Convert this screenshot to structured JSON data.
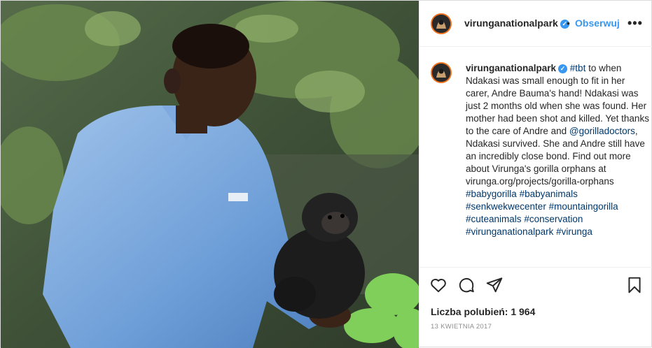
{
  "post": {
    "username": "virunganationalpark",
    "verified": "✓",
    "separator": "•",
    "follow_label": "Obserwuj",
    "more_label": "•••",
    "photo_alt": "Andre Bauma holding baby gorilla Ndakasi",
    "caption": {
      "username": "virunganationalpark",
      "hashtag_tbt": "#tbt",
      "text_1": " to when Ndakasi was small enough to fit in her carer, Andre Bauma's hand! Ndakasi was just 2 months old when she was found. Her mother had been shot and killed. Yet thanks to the care of Andre and ",
      "mention": "@gorilladoctors",
      "text_2": ", Ndakasi survived. She and Andre still have an incredibly close bond. Find out more about Virunga's gorilla orphans at virunga.org/projects/gorilla-orphans",
      "tags": [
        "#babygorilla",
        "#babyanimals",
        "#senkwekwecenter",
        "#mountaingorilla",
        "#cuteanimals",
        "#conservation",
        "#virunganationalpark",
        "#virunga"
      ]
    },
    "likes_label": "Liczba polubień: 1 964",
    "date": "13 kwietnia 2017"
  },
  "icons": {
    "like": "heart-icon",
    "comment": "comment-icon",
    "share": "share-icon",
    "save": "bookmark-icon"
  },
  "colors": {
    "accent": "#3897f0",
    "link": "#00376b",
    "avatar_ring": "#f0711c",
    "muted": "#8e8e8e"
  }
}
